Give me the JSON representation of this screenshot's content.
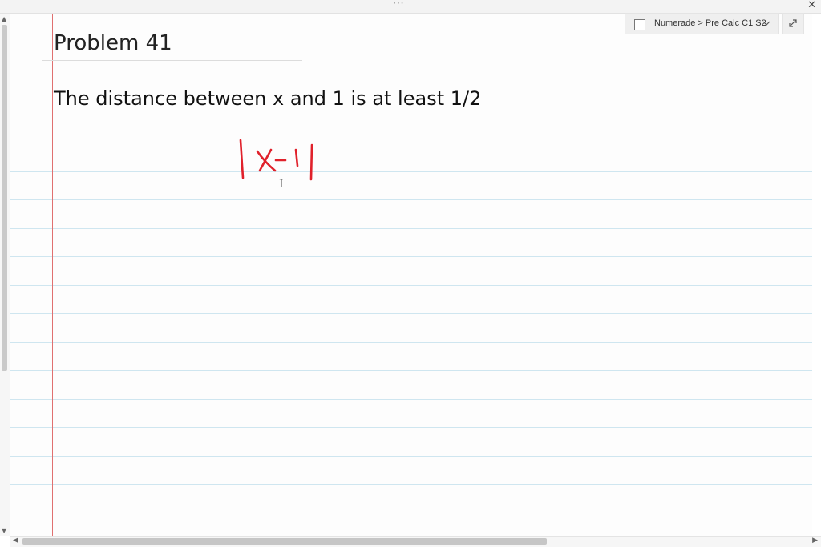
{
  "window": {
    "menu_dots": "···",
    "close_label": "✕"
  },
  "note": {
    "title": "Problem 41",
    "statement": "The distance between x and 1 is at least 1/2"
  },
  "breadcrumb": {
    "text": "Numerade > Pre Calc C1 S2"
  },
  "handwriting": {
    "expression": "|x-1|",
    "color": "#e0212b"
  },
  "icons": {
    "breadcrumb_checkbox": "checkbox-icon",
    "breadcrumb_dropdown": "chevron-down-icon",
    "expand": "expand-icon",
    "text_cursor": "i-beam-cursor-icon"
  },
  "colors": {
    "page_background": "#fdfdfd",
    "rule_lines": "#cfe6f0",
    "margin_line": "#e07070",
    "ink": "#e0212b"
  }
}
